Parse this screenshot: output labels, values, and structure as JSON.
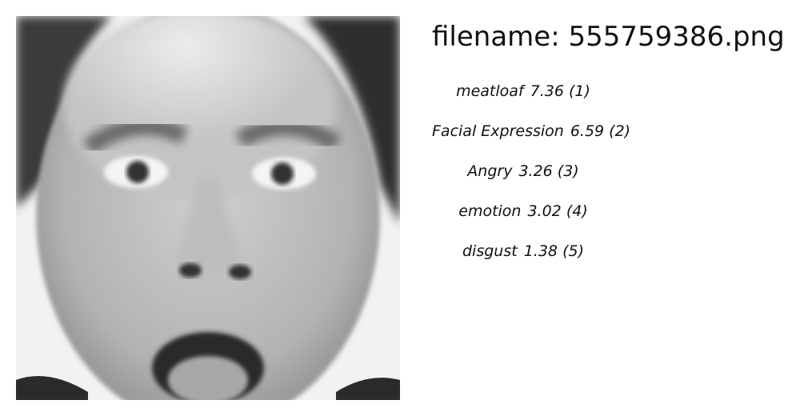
{
  "filename_prefix": "filename:",
  "filename": "555759386.png",
  "predictions": [
    {
      "label": "meatloaf",
      "score": "7.36",
      "rank": "(1)"
    },
    {
      "label": "Facial Expression",
      "score": "6.59",
      "rank": "(2)"
    },
    {
      "label": "Angry",
      "score": "3.26",
      "rank": "(3)"
    },
    {
      "label": "emotion",
      "score": "3.02",
      "rank": "(4)"
    },
    {
      "label": "disgust",
      "score": "1.38",
      "rank": "(5)"
    }
  ]
}
